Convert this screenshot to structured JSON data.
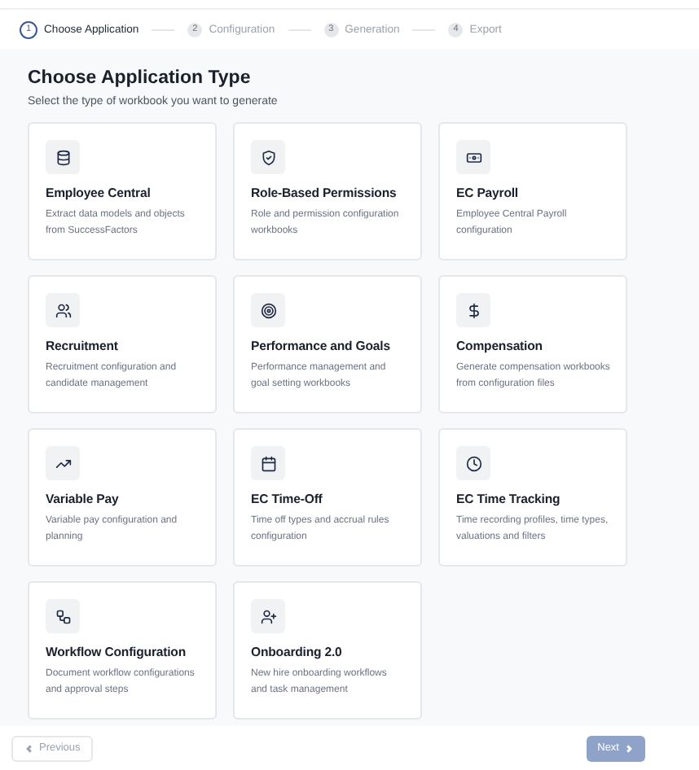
{
  "stepper": [
    {
      "number": "1",
      "label": "Choose Application",
      "selected": true
    },
    {
      "number": "2",
      "label": "Configuration",
      "selected": false
    },
    {
      "number": "3",
      "label": "Generation",
      "selected": false
    },
    {
      "number": "4",
      "label": "Export",
      "selected": false
    }
  ],
  "heading": "Choose Application Type",
  "subtitle": "Select the type of workbook you want to generate",
  "cards": [
    {
      "title": "Employee Central",
      "description": "Extract data models and objects from SuccessFactors"
    },
    {
      "title": "Role-Based Permissions",
      "description": "Role and permission configuration workbooks"
    },
    {
      "title": "EC Payroll",
      "description": "Employee Central Payroll configuration"
    },
    {
      "title": "Recruitment",
      "description": "Recruitment configuration and candidate management"
    },
    {
      "title": "Performance and Goals",
      "description": "Performance management and goal setting workbooks"
    },
    {
      "title": "Compensation",
      "description": "Generate compensation workbooks from configuration files"
    },
    {
      "title": "Variable Pay",
      "description": "Variable pay configuration and planning"
    },
    {
      "title": "EC Time-Off",
      "description": "Time off types and accrual rules configuration"
    },
    {
      "title": "EC Time Tracking",
      "description": "Time recording profiles, time types, valuations and filters"
    },
    {
      "title": "Workflow Configuration",
      "description": "Document workflow configurations and approval steps"
    },
    {
      "title": "Onboarding 2.0",
      "description": "New hire onboarding workflows and task management"
    }
  ],
  "footer": {
    "previous": {
      "label": "Previous",
      "disabled": true
    },
    "next": {
      "label": "Next",
      "disabled": true
    }
  }
}
